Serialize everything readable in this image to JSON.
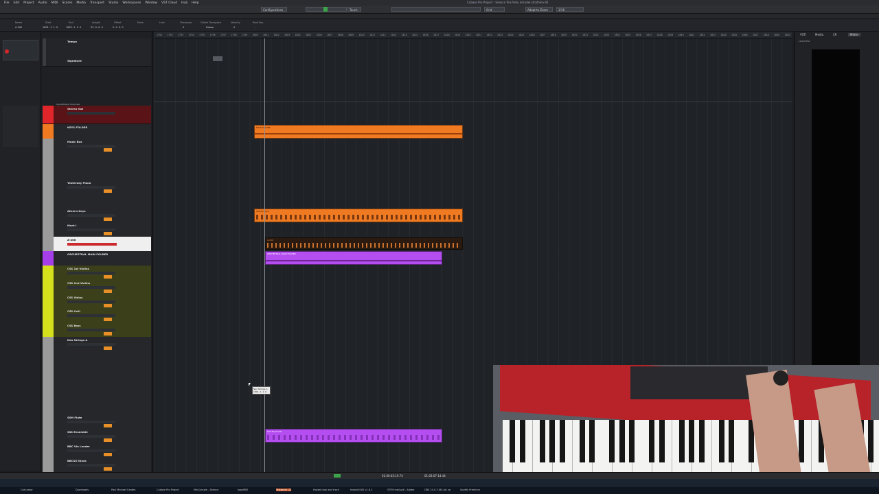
{
  "menu": {
    "items": [
      "File",
      "Edit",
      "Project",
      "Audio",
      "MIDI",
      "Scores",
      "Media",
      "Transport",
      "Studio",
      "Workspaces",
      "Window",
      "VST Cloud",
      "Hub",
      "Help"
    ],
    "title": "Cubase Pro Project - Seance Tea Party intruder.strathmo-02"
  },
  "toolbar": {
    "configurations": "Configurations",
    "touch": "Touch",
    "grid": "Grid",
    "quantize": "1/16",
    "adapt": "Adapt to Zoom"
  },
  "infoline": {
    "headers": [
      "Name",
      "Start",
      "End",
      "Length",
      "Offset",
      "Mute",
      "Lock",
      "Transpose",
      "Global Transpose",
      "Velocity",
      "Root Key"
    ],
    "values": [
      "A-200",
      "1801. 1. 1. 0",
      "1822. 1. 1. 0",
      "22. 0. 0. 0",
      "0. 0. 0. 0",
      "",
      "",
      "0",
      "Follow",
      "0",
      "-"
    ]
  },
  "ruler": {
    "bars": [
      "1791",
      "1792",
      "1793",
      "1794",
      "1795",
      "1796",
      "1797",
      "1798",
      "1799",
      "1800",
      "1801",
      "1802",
      "1803",
      "1804",
      "1805",
      "1806",
      "1807",
      "1808",
      "1809",
      "1810",
      "1811",
      "1812",
      "1813",
      "1814",
      "1815",
      "1816",
      "1817",
      "1818",
      "1819",
      "1820",
      "1821",
      "1822",
      "1823",
      "1824",
      "1825",
      "1826",
      "1827",
      "1828",
      "1829",
      "1830",
      "1831",
      "1832",
      "1833",
      "1834",
      "1835",
      "1836",
      "1837",
      "1838",
      "1839",
      "1840",
      "1841",
      "1842",
      "1843",
      "1844",
      "1845",
      "1846",
      "1847",
      "1848",
      "1849",
      "1850",
      "1851",
      "1852"
    ]
  },
  "tracks": [
    {
      "name": "Tempo",
      "color": "#555"
    },
    {
      "name": "Signature",
      "color": "#555"
    },
    {
      "name": "Stereo Out",
      "color": "#e0262a"
    },
    {
      "name": "KEYS FOLDER",
      "color": "#f07a22"
    },
    {
      "name": "Music Box",
      "color": "#8a8a8a"
    },
    {
      "name": "Yesterday Piano",
      "color": "#8a8a8a"
    },
    {
      "name": "Alicia's Keys",
      "color": "#8a8a8a"
    },
    {
      "name": "Mark I",
      "color": "#8a8a8a"
    },
    {
      "name": "A-200",
      "color": "#e0262a"
    },
    {
      "name": "ORCHESTRAL MAIN FOLDER",
      "color": "#a43ee8"
    },
    {
      "name": "CSS 1st Violins",
      "color": "#d5e01c"
    },
    {
      "name": "CSS 2nd Violins",
      "color": "#d5e01c"
    },
    {
      "name": "CSS Violas",
      "color": "#d5e01c"
    },
    {
      "name": "CSS Celli",
      "color": "#d5e01c"
    },
    {
      "name": "CSS Bass",
      "color": "#d5e01c"
    },
    {
      "name": "Neo Strings A",
      "color": "#8a8a8a"
    },
    {
      "name": "SSM Flute",
      "color": "#8a8a8a"
    },
    {
      "name": "SSS Ensemble",
      "color": "#8a8a8a"
    },
    {
      "name": "BBC Vln Leader",
      "color": "#8a8a8a"
    },
    {
      "name": "BBCSO Glock",
      "color": "#8a8a8a"
    }
  ],
  "section_label": "Input/Output Channels",
  "events": [
    {
      "label": "KEYS FOLDER",
      "color": "#ef7a22"
    },
    {
      "label": "Alicia's Keys",
      "color": "#ef7a22"
    },
    {
      "label": "A-200",
      "color": "#2a1a10"
    },
    {
      "label": "ORCHESTRAL MAIN FOLDER",
      "color": "#b44ef0"
    },
    {
      "label": "SSS Ensemble",
      "color": "#b44ef0"
    }
  ],
  "tooltip": {
    "line1": "Neo Strings A",
    "line2": "1801. 1. 1. 0"
  },
  "rightpanel": {
    "tabs": [
      "VSTi",
      "Media",
      "CR",
      "Meter"
    ],
    "label": "Loudness"
  },
  "status": {
    "time1": "01:00:45:19.74",
    "time2": "01:03:07:14.44"
  },
  "taskbar": {
    "items": [
      "Calculator",
      "Downloads",
      "Paul Michael Carden",
      "Cubase Pro Project",
      "MixConsole - Seance",
      "loopMIDI",
      "Telegram (2)",
      "Hosted tool and track",
      "foobar2000 v1.6.2",
      "STFM mail.pdf - Adobe",
      "OBS 24.0.3 (64-bit, wi",
      "Spotify Premium"
    ]
  }
}
